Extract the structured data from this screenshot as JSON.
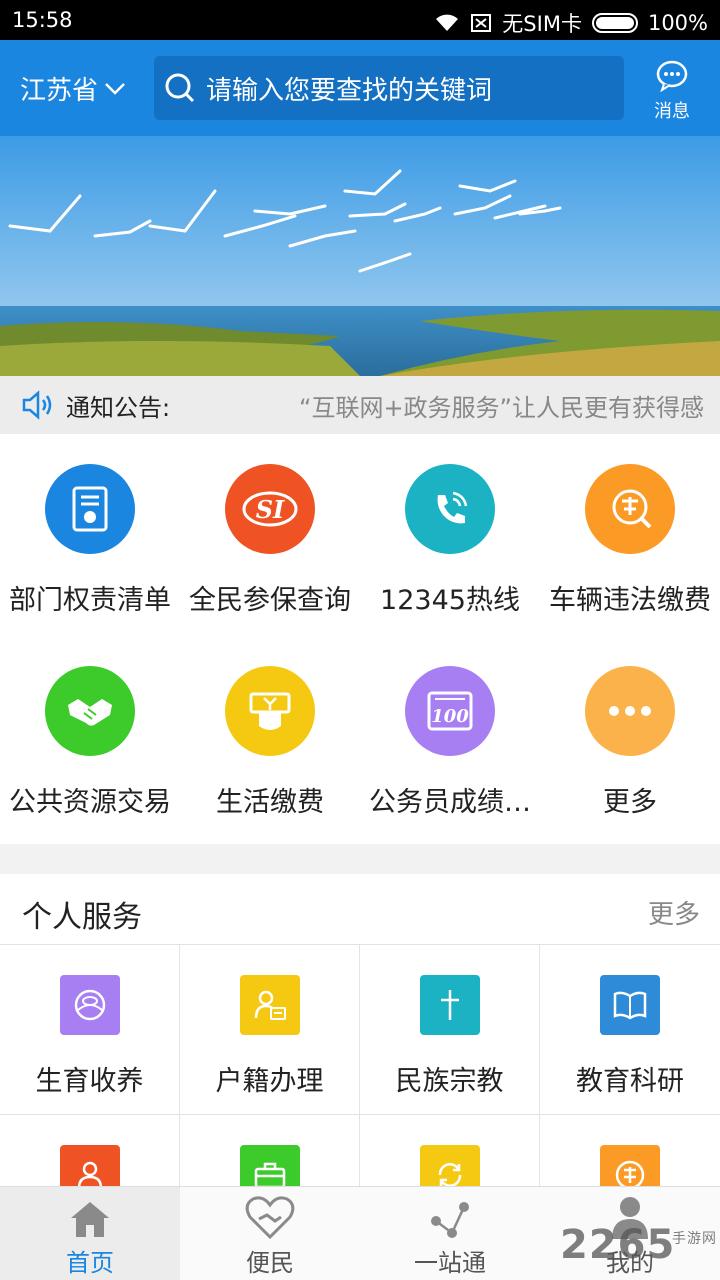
{
  "status_bar": {
    "time": "15:58",
    "sim": "无SIM卡",
    "battery": "100%"
  },
  "header": {
    "province": "江苏省",
    "search_placeholder": "请输入您要查找的关键词",
    "message_label": "消息"
  },
  "notice": {
    "label": "通知公告:",
    "text": "“互联网+政务服务”让人民更有获得感"
  },
  "services": [
    {
      "label": "部门权责清单",
      "icon": "document-icon",
      "color": "#1a86e0"
    },
    {
      "label": "全民参保查询",
      "icon": "si-icon",
      "color": "#ef5323"
    },
    {
      "label": "12345热线",
      "icon": "phone-icon",
      "color": "#1bb3c4"
    },
    {
      "label": "车辆违法缴费",
      "icon": "violation-icon",
      "color": "#fb9a24"
    },
    {
      "label": "公共资源交易",
      "icon": "handshake-icon",
      "color": "#3dcb2c"
    },
    {
      "label": "生活缴费",
      "icon": "bill-icon",
      "color": "#f5c812"
    },
    {
      "label": "公务员成绩…",
      "icon": "score-icon",
      "color": "#a77ff2"
    },
    {
      "label": "更多",
      "icon": "more-dots-icon",
      "color": "#fbb24a"
    }
  ],
  "personal_services": {
    "title": "个人服务",
    "more": "更多",
    "items": [
      {
        "label": "生育收养",
        "icon": "birth-icon",
        "color": "#a77ff2"
      },
      {
        "label": "户籍办理",
        "icon": "household-icon",
        "color": "#f5c812"
      },
      {
        "label": "民族宗教",
        "icon": "religion-icon",
        "color": "#1bb3c4"
      },
      {
        "label": "教育科研",
        "icon": "book-icon",
        "color": "#2e8bd8"
      },
      {
        "label": "",
        "icon": "people-icon",
        "color": "#ef5323"
      },
      {
        "label": "",
        "icon": "briefcase-icon",
        "color": "#3dcb2c"
      },
      {
        "label": "",
        "icon": "refresh-icon",
        "color": "#f5c812"
      },
      {
        "label": "",
        "icon": "permit-icon",
        "color": "#fb9a24"
      }
    ]
  },
  "bottom_nav": [
    {
      "label": "首页",
      "icon": "home-icon",
      "active": true
    },
    {
      "label": "便民",
      "icon": "heart-hands-icon",
      "active": false
    },
    {
      "label": "一站通",
      "icon": "share-nodes-icon",
      "active": false
    },
    {
      "label": "我的",
      "icon": "user-icon",
      "active": false
    }
  ],
  "watermark": {
    "text": "2265",
    "sub": "手游网"
  }
}
